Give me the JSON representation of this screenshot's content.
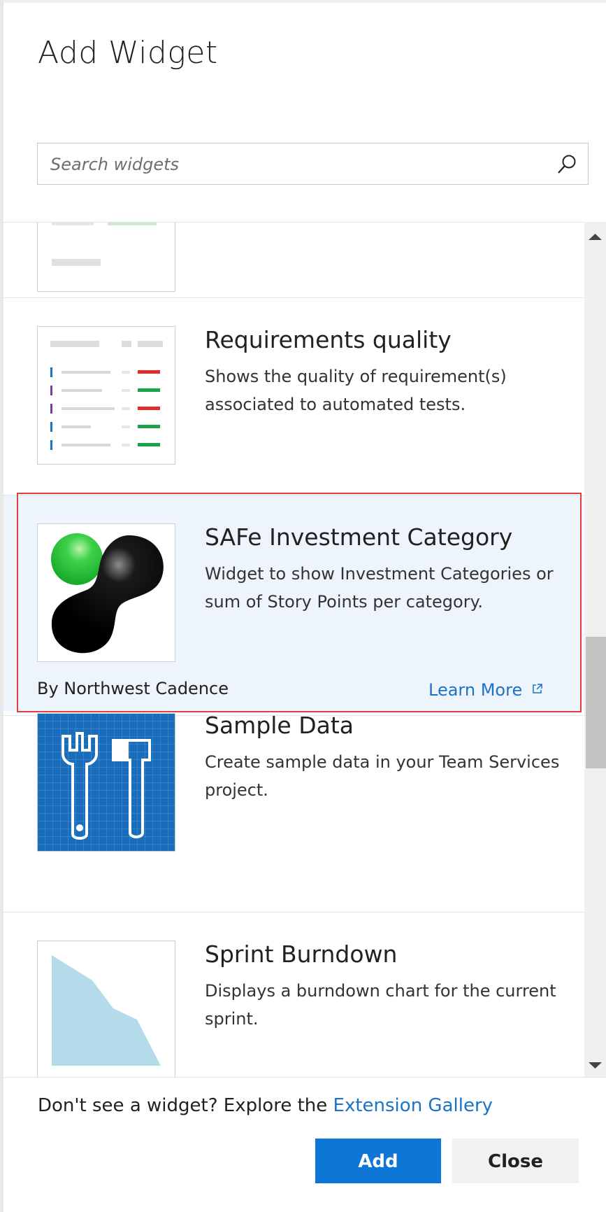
{
  "dialog": {
    "title": "Add Widget",
    "search": {
      "placeholder": "Search widgets",
      "icon": "search-icon"
    }
  },
  "widgets": [
    {
      "name": "",
      "description": "",
      "icon": "partial-widget-thumbnail"
    },
    {
      "name": "Requirements quality",
      "description": "Shows the quality of requirement(s) associated to automated tests.",
      "icon": "requirements-list-thumbnail"
    },
    {
      "name": "SAFe Investment Category",
      "description": "Widget to show Investment Categories or sum of Story Points per category.",
      "publisher": "By Northwest Cadence",
      "learn_more": "Learn More",
      "selected": true,
      "icon": "northwest-cadence-logo"
    },
    {
      "name": "Sample Data",
      "description": "Create sample data in your Team Services project.",
      "icon": "tools-blueprint-thumbnail"
    },
    {
      "name": "Sprint Burndown",
      "description": "Displays a burndown chart for the current sprint.",
      "icon": "burndown-chart-thumbnail"
    }
  ],
  "footer": {
    "prompt": "Don't see a widget? Explore the ",
    "gallery_link": "Extension Gallery",
    "add_label": "Add",
    "close_label": "Close"
  },
  "colors": {
    "accent": "#0e76d7",
    "selection_outline": "#e0403f",
    "selection_bg": "#eef4fb",
    "link": "#1b73c7"
  }
}
